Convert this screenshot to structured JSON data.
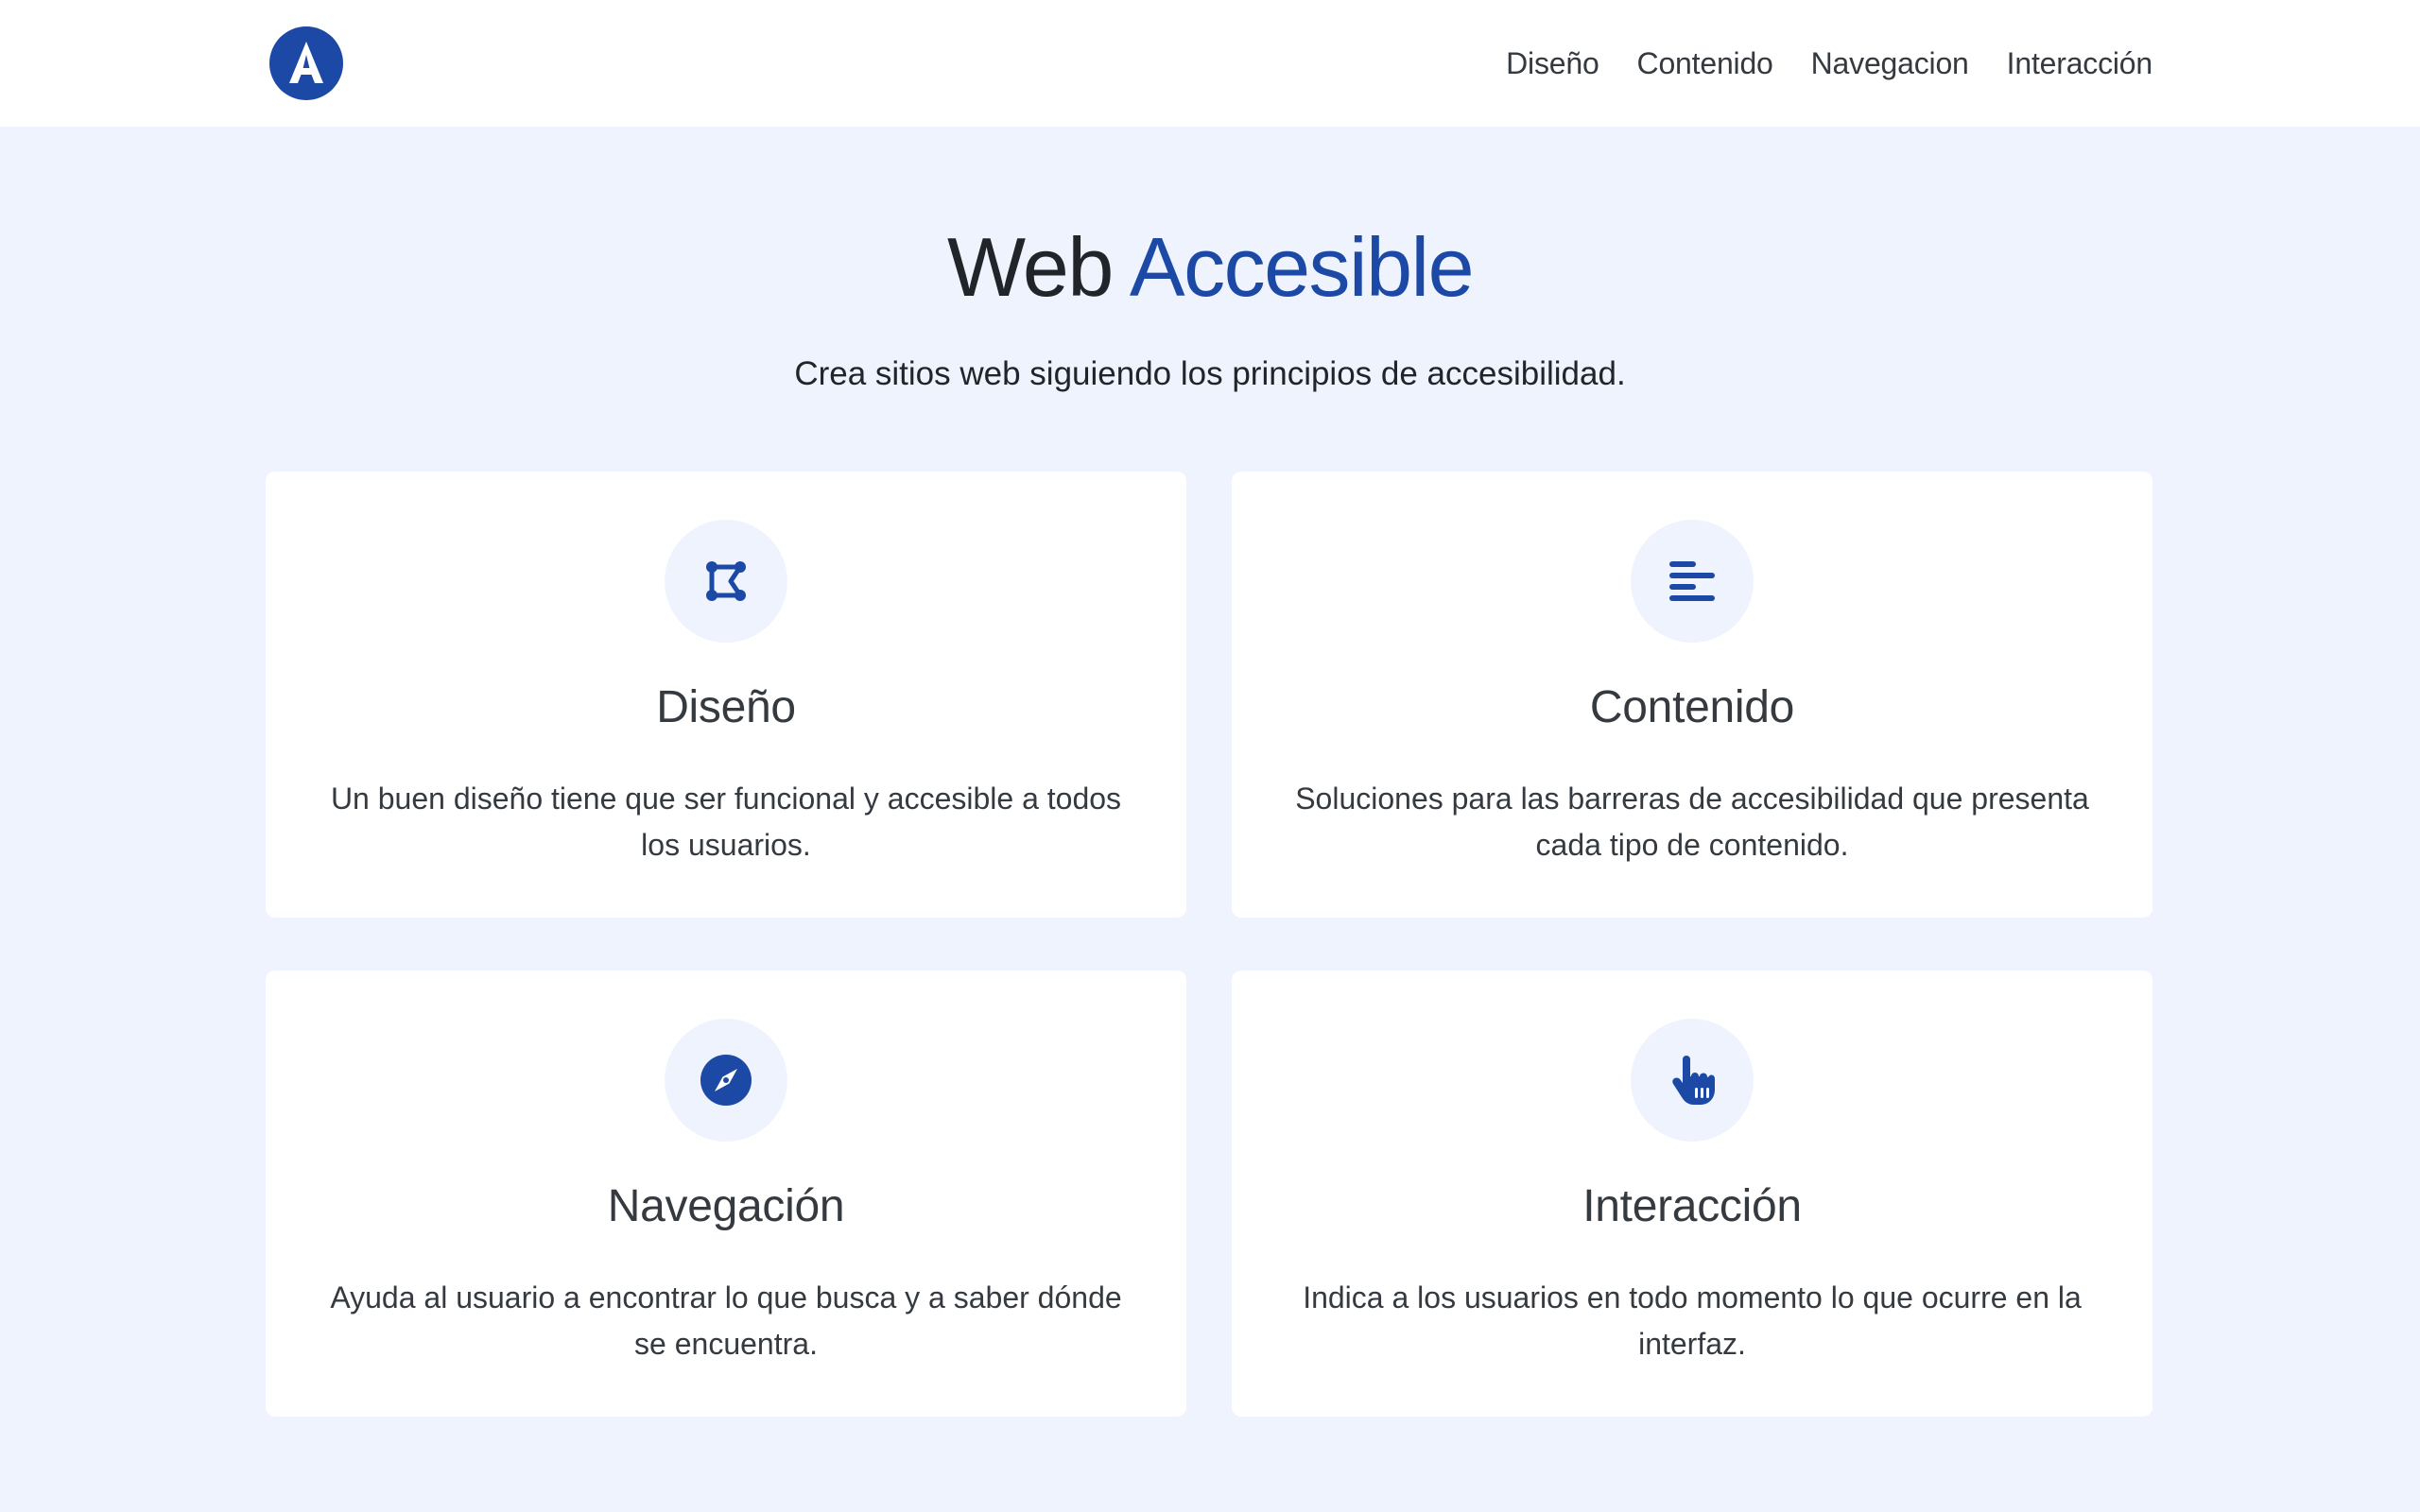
{
  "colors": {
    "accent": "#1c49a5",
    "background": "#eef3fd",
    "card": "#ffffff",
    "text": "#343a40"
  },
  "header": {
    "logo_icon": "accessibility-a-logo",
    "nav": [
      {
        "label": "Diseño"
      },
      {
        "label": "Contenido"
      },
      {
        "label": "Navegacion"
      },
      {
        "label": "Interacción"
      }
    ]
  },
  "hero": {
    "title_part1": "Web",
    "title_part2": "Accesible",
    "subtitle": "Crea sitios web siguiendo los principios de accesibilidad."
  },
  "cards": [
    {
      "icon": "vector-shape-icon",
      "title": "Diseño",
      "text": "Un buen diseño tiene que ser funcional y accesible a todos los usuarios."
    },
    {
      "icon": "align-left-icon",
      "title": "Contenido",
      "text": "Soluciones para las barreras de accesibilidad que presenta cada tipo de contenido."
    },
    {
      "icon": "compass-icon",
      "title": "Navegación",
      "text": "Ayuda al usuario a encontrar lo que busca y a saber dónde se encuentra."
    },
    {
      "icon": "hand-pointer-icon",
      "title": "Interacción",
      "text": "Indica a los usuarios en todo momento lo que ocurre en la interfaz."
    }
  ]
}
